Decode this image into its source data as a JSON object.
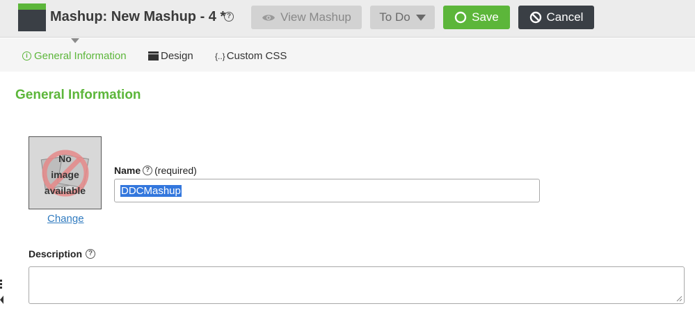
{
  "header": {
    "title": "Mashup: New Mashup - 4 *",
    "help_glyph": "?",
    "buttons": {
      "view_label": "View Mashup",
      "todo_label": "To Do",
      "save_label": "Save",
      "cancel_label": "Cancel"
    },
    "icons": {
      "app": "mashup-icon",
      "view": "eye-icon",
      "todo": "caret-down-icon",
      "save": "circle-icon",
      "cancel": "prohibited-icon"
    }
  },
  "tabs": [
    {
      "label": "General Information",
      "icon": "info-icon",
      "active": true
    },
    {
      "label": "Design",
      "icon": "design-icon",
      "active": false
    },
    {
      "label": "Custom CSS",
      "icon": "curly-braces-icon",
      "icon_text": "{..}",
      "active": false
    }
  ],
  "main": {
    "section_title": "General Information",
    "image": {
      "line1": "No",
      "line2": "image",
      "line3": "available",
      "change_label": "Change"
    },
    "name": {
      "label": "Name",
      "required": "(required)",
      "value": "DDCMashup"
    },
    "description": {
      "label": "Description",
      "value": ""
    }
  },
  "colors": {
    "accent": "#5cb63a",
    "dark": "#3a3f45",
    "link": "#2f7abf",
    "selection": "#3377dd"
  }
}
